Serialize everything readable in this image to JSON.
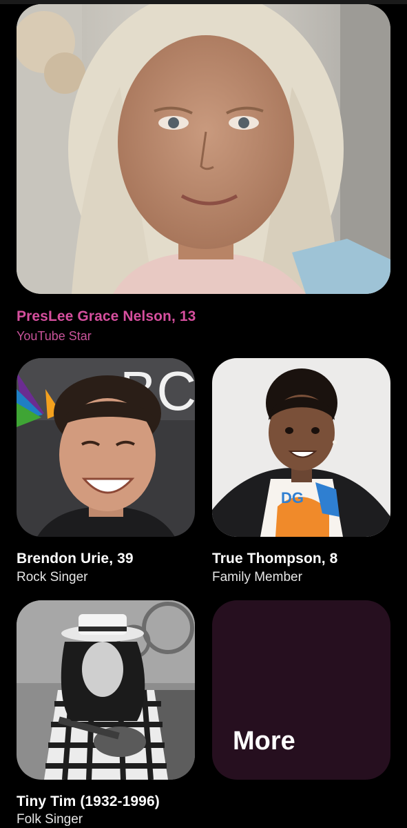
{
  "featured": {
    "name": "PresLee Grace Nelson, 13",
    "role": "YouTube Star"
  },
  "people": [
    {
      "name": "Brendon Urie, 39",
      "role": "Rock Singer",
      "photo_backdrop_text": "BC"
    },
    {
      "name": "True Thompson, 8",
      "role": "Family Member",
      "shirt_text": "DG"
    },
    {
      "name": "Tiny Tim (1932-1996)",
      "role": "Folk Singer"
    }
  ],
  "more": {
    "label": "More"
  },
  "colors": {
    "background": "#000000",
    "featured_accent": "#d64f9e",
    "more_tile": "#260f1f"
  }
}
